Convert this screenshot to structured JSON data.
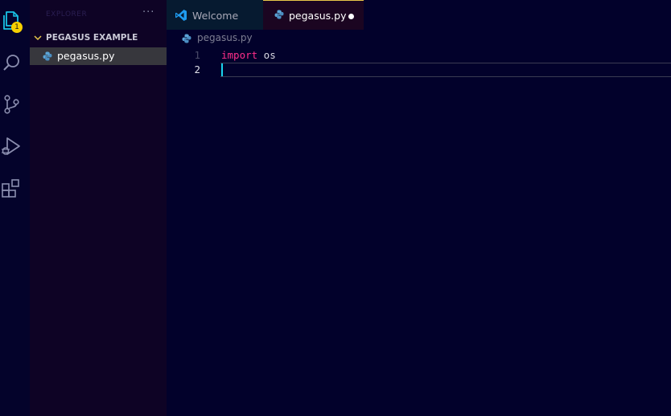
{
  "activity_bar": {
    "explorer_badge": "1",
    "items": [
      "explorer-icon",
      "search-icon",
      "source-control-icon",
      "run-debug-icon",
      "extensions-icon"
    ]
  },
  "sidebar": {
    "title": "EXPLORER",
    "more_actions": "···",
    "folder_name": "PEGASUS EXAMPLE",
    "files": [
      {
        "name": "pegasus.py",
        "selected": true
      }
    ]
  },
  "tabs": [
    {
      "label": "Welcome",
      "icon": "vscode-icon",
      "active": false
    },
    {
      "label": "pegasus.py",
      "icon": "python-icon",
      "active": true,
      "dirty": true
    }
  ],
  "breadcrumb": {
    "file": "pegasus.py"
  },
  "editor": {
    "lines": [
      {
        "number": "1",
        "keyword": "import",
        "rest": " os"
      },
      {
        "number": "2",
        "keyword": "",
        "rest": ""
      }
    ]
  },
  "colors": {
    "background": "#02012b",
    "sidebar": "#0e0325",
    "keyword": "#ff2e8a",
    "cursor": "#19d3f0",
    "badge": "#f5d000",
    "active_tab_border": "#e8c84a"
  }
}
